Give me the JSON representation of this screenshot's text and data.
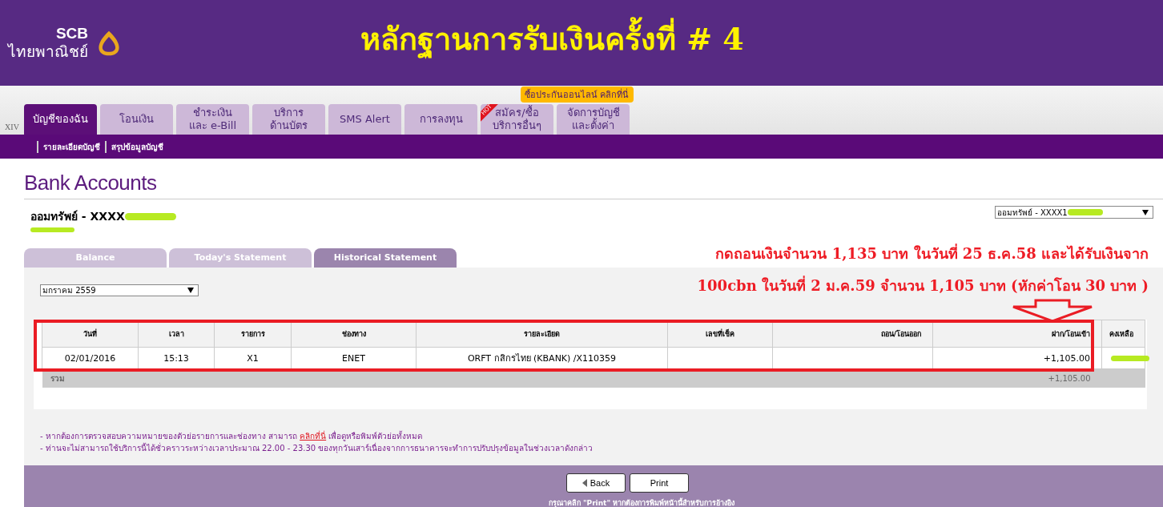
{
  "header": {
    "logo_lines": [
      "SCB",
      "ไทยพาณิชย์"
    ],
    "title": "หลักฐานการรับเงินครั้งที่ # 4",
    "promo": "ซื้อประกันออนไลน์ คลิกที่นี่"
  },
  "nav": {
    "version": "XIV",
    "tabs": [
      {
        "label": "บัญชีของฉัน",
        "selected": true
      },
      {
        "label": "โอนเงิน",
        "selected": false
      },
      {
        "label": "ชำระเงิน\nและ e-Bill",
        "selected": false
      },
      {
        "label": "บริการ\nด้านบัตร",
        "selected": false
      },
      {
        "label": "SMS Alert",
        "selected": false
      },
      {
        "label": "การลงทุน",
        "selected": false
      },
      {
        "label": "สมัคร/ซื้อ\nบริการอื่นๆ",
        "selected": false,
        "badge": "HOT"
      },
      {
        "label": "จัดการบัญชี\nและตั้งค่า",
        "selected": false
      }
    ]
  },
  "subnav": {
    "items": [
      "รายละเอียดบัญชี",
      "สรุปข้อมูลบัญชี"
    ]
  },
  "page_title": "Bank Accounts",
  "account": {
    "name": "ออมทรัพย์ - XXXX",
    "selector": "ออมทรัพย์ - XXXX1"
  },
  "annotation": {
    "lines": [
      "กดถอนเงินจำนวน 1,135 บาท ในวันที่ 25 ธ.ค.58 และได้รับเงินจาก",
      "100cbn ในวันที่ 2 ม.ค.59 จำนวน 1,105 บาท (หักค่าโอน 30 บาท )"
    ]
  },
  "statement_tabs": [
    {
      "label": "Balance",
      "selected": false
    },
    {
      "label": "Today's Statement",
      "selected": false
    },
    {
      "label": "Historical Statement",
      "selected": true
    }
  ],
  "month_select": "มกราคม 2559",
  "table": {
    "columns": [
      "วันที่",
      "เวลา",
      "รายการ",
      "ช่องทาง",
      "รายละเอียด",
      "เลขที่เช็ค",
      "ถอน/โอนออก",
      "ฝาก/โอนเข้า",
      "คงเหลือ"
    ],
    "rows": [
      {
        "date": "02/01/2016",
        "time": "15:13",
        "code": "X1",
        "channel": "ENET",
        "detail": "ORFT กสิกรไทย (KBANK) /X110359",
        "deposit": "+1,105.00"
      }
    ],
    "total": {
      "label": "รวม",
      "deposit": "+1,105.00"
    }
  },
  "notes": [
    {
      "before": "- หากต้องการตรวจสอบความหมายของตัวย่อรายการและช่องทาง สามารถ ",
      "link": "คลิกที่นี่",
      "after": " เพื่อดูหรือพิมพ์ตัวย่อทั้งหมด"
    },
    {
      "before": "- ท่านจะไม่สามารถใช้บริการนี้ได้ชั่วคราวระหว่างเวลาประมาณ 22.00 - 23.30 ของทุกวันเสาร์เนื่องจากการธนาคารจะทำการปรับปรุงข้อมูลในช่วงเวลาดังกล่าว"
    }
  ],
  "buttons": [
    "Back",
    "Print"
  ],
  "footer_note": "กรุณาคลิก \"Print\" หากต้องการพิมพ์หน้านี้สำหรับการอ้างอิง"
}
